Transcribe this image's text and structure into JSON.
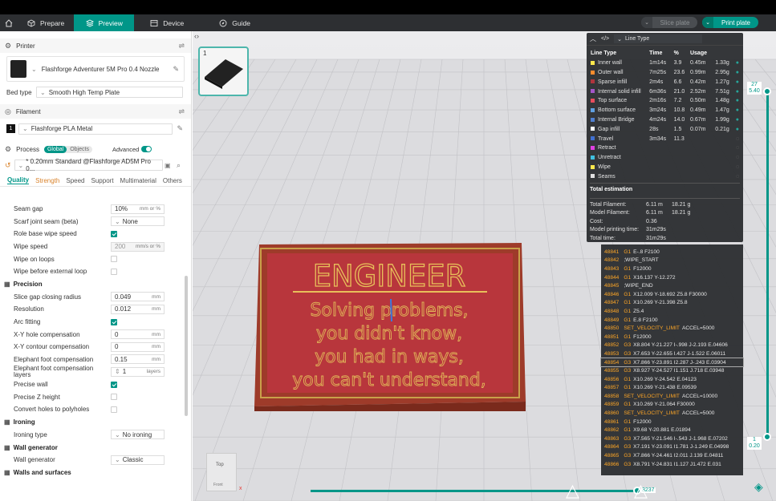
{
  "nav": {
    "tabs": [
      {
        "label": "Prepare"
      },
      {
        "label": "Preview"
      },
      {
        "label": "Device"
      },
      {
        "label": "Guide"
      }
    ],
    "slice": "Slice plate",
    "print": "Print plate"
  },
  "printer": {
    "section": "Printer",
    "name": "Flashforge Adventurer 5M Pro 0.4 Nozzle",
    "bedtype_label": "Bed type",
    "bedtype": "Smooth High Temp Plate"
  },
  "filament": {
    "section": "Filament",
    "index": "1",
    "name": "Flashforge PLA Metal"
  },
  "process": {
    "section": "Process",
    "global": "Global",
    "objects": "Objects",
    "advanced": "Advanced",
    "preset": "* 0.20mm Standard @Flashforge AD5M Pro 0...",
    "tabs": [
      "Quality",
      "Strength",
      "Speed",
      "Support",
      "Multimaterial",
      "Others"
    ]
  },
  "params": [
    {
      "kind": "row",
      "label": "Seam gap",
      "type": "input",
      "value": "10%",
      "unit": "mm or %"
    },
    {
      "kind": "row",
      "label": "Scarf joint seam (beta)",
      "type": "select",
      "value": "None"
    },
    {
      "kind": "row",
      "label": "Role base wipe speed",
      "type": "check",
      "on": true
    },
    {
      "kind": "row",
      "label": "Wipe speed",
      "type": "input",
      "value": "200",
      "unit": "mm/s or %",
      "disabled": true
    },
    {
      "kind": "row",
      "label": "Wipe on loops",
      "type": "check",
      "on": false
    },
    {
      "kind": "row",
      "label": "Wipe before external loop",
      "type": "check",
      "on": false
    },
    {
      "kind": "group",
      "label": "Precision"
    },
    {
      "kind": "row",
      "label": "Slice gap closing radius",
      "type": "input",
      "value": "0.049",
      "unit": "mm"
    },
    {
      "kind": "row",
      "label": "Resolution",
      "type": "input",
      "value": "0.012",
      "unit": "mm"
    },
    {
      "kind": "row",
      "label": "Arc fitting",
      "type": "check",
      "on": true
    },
    {
      "kind": "row",
      "label": "X-Y hole compensation",
      "type": "input",
      "value": "0",
      "unit": "mm"
    },
    {
      "kind": "row",
      "label": "X-Y contour compensation",
      "type": "input",
      "value": "0",
      "unit": "mm"
    },
    {
      "kind": "row",
      "label": "Elephant foot compensation",
      "type": "input",
      "value": "0.15",
      "unit": "mm"
    },
    {
      "kind": "row",
      "label": "Elephant foot compensation layers",
      "type": "spin",
      "value": "1",
      "unit": "layers"
    },
    {
      "kind": "row",
      "label": "Precise wall",
      "type": "check",
      "on": true
    },
    {
      "kind": "row",
      "label": "Precise Z height",
      "type": "check",
      "on": false
    },
    {
      "kind": "row",
      "label": "Convert holes to polyholes",
      "type": "check",
      "on": false
    },
    {
      "kind": "group",
      "label": "Ironing"
    },
    {
      "kind": "row",
      "label": "Ironing type",
      "type": "select",
      "value": "No ironing"
    },
    {
      "kind": "group",
      "label": "Wall generator"
    },
    {
      "kind": "row",
      "label": "Wall generator",
      "type": "select",
      "value": "Classic"
    },
    {
      "kind": "group",
      "label": "Walls and surfaces"
    }
  ],
  "viewport": {
    "plate_num": "1",
    "view_top": "Top",
    "view_front": "Front",
    "layer_top": "27",
    "layer_top_z": "5.40",
    "layer_bot": "1",
    "layer_bot_z": "0.20",
    "move": "3237",
    "sign": {
      "title": "ENGINEER",
      "lines": [
        "Solving problems,",
        "you didn't know,",
        "you had in ways,",
        "you can't understand,"
      ]
    }
  },
  "legend": {
    "dropdown": "Line Type",
    "headers": [
      "Line Type",
      "Time",
      "%",
      "Usage"
    ],
    "rows": [
      {
        "name": "Inner wall",
        "color": "#ffe84d",
        "time": "1m14s",
        "pct": "3.9",
        "len": "0.45m",
        "g": "1.33g"
      },
      {
        "name": "Outer wall",
        "color": "#ff8c2e",
        "time": "7m25s",
        "pct": "23.6",
        "len": "0.99m",
        "g": "2.95g"
      },
      {
        "name": "Sparse infill",
        "color": "#b0343d",
        "time": "2m4s",
        "pct": "6.6",
        "len": "0.42m",
        "g": "1.27g"
      },
      {
        "name": "Internal solid infill",
        "color": "#a456c9",
        "time": "6m36s",
        "pct": "21.0",
        "len": "2.52m",
        "g": "7.51g"
      },
      {
        "name": "Top surface",
        "color": "#e84d5d",
        "time": "2m16s",
        "pct": "7.2",
        "len": "0.50m",
        "g": "1.48g"
      },
      {
        "name": "Bottom surface",
        "color": "#60a0e0",
        "time": "3m24s",
        "pct": "10.8",
        "len": "0.49m",
        "g": "1.47g"
      },
      {
        "name": "Internal Bridge",
        "color": "#5080d0",
        "time": "4m24s",
        "pct": "14.0",
        "len": "0.67m",
        "g": "1.99g"
      },
      {
        "name": "Gap infill",
        "color": "#ffffff",
        "time": "28s",
        "pct": "1.5",
        "len": "0.07m",
        "g": "0.21g"
      },
      {
        "name": "Travel",
        "color": "#4070d0",
        "time": "3m34s",
        "pct": "11.3",
        "len": "",
        "g": ""
      },
      {
        "name": "Retract",
        "color": "#e040e0",
        "time": "",
        "pct": "",
        "len": "",
        "g": ""
      },
      {
        "name": "Unretract",
        "color": "#40c0e0",
        "time": "",
        "pct": "",
        "len": "",
        "g": ""
      },
      {
        "name": "Wipe",
        "color": "#ffe84d",
        "time": "",
        "pct": "",
        "len": "",
        "g": ""
      },
      {
        "name": "Seams",
        "color": "#e0e0e0",
        "time": "",
        "pct": "",
        "len": "",
        "g": ""
      }
    ],
    "total_label": "Total estimation",
    "totals": [
      {
        "k": "Total Filament:",
        "v1": "6.11 m",
        "v2": "18.21 g"
      },
      {
        "k": "Model Filament:",
        "v1": "6.11 m",
        "v2": "18.21 g"
      },
      {
        "k": "Cost:",
        "v1": "0.36",
        "v2": ""
      },
      {
        "k": "Model printing time:",
        "v1": "31m29s",
        "v2": ""
      },
      {
        "k": "Total time:",
        "v1": "31m29s",
        "v2": ""
      }
    ]
  },
  "gcode": [
    {
      "n": "48841",
      "c": "G1",
      "t": "E-.8 F2100"
    },
    {
      "n": "48842",
      "c": "",
      "t": ";WIPE_START"
    },
    {
      "n": "48843",
      "c": "G1",
      "t": "F12000"
    },
    {
      "n": "48844",
      "c": "G1",
      "t": "X16.137 Y-12.272"
    },
    {
      "n": "48845",
      "c": "",
      "t": ";WIPE_END"
    },
    {
      "n": "48846",
      "c": "G1",
      "t": "X12.009 Y-18.692 Z5.8 F30000"
    },
    {
      "n": "48847",
      "c": "G1",
      "t": "X10.269 Y-21.398 Z5.8"
    },
    {
      "n": "48848",
      "c": "G1",
      "t": "Z5.4"
    },
    {
      "n": "48849",
      "c": "G1",
      "t": "E.8 F2100"
    },
    {
      "n": "48850",
      "c": "SET_VELOCITY_LIMIT",
      "t": "ACCEL=5000"
    },
    {
      "n": "48851",
      "c": "G1",
      "t": "F12000"
    },
    {
      "n": "48852",
      "c": "G3",
      "t": "X8.804 Y-21.227 I-.998 J-2.193 E.04606"
    },
    {
      "n": "48853",
      "c": "G3",
      "t": "X7.653 Y-22.655 I.427 J-1.522 E.06011"
    },
    {
      "n": "48854",
      "c": "G3",
      "t": "X7.866 Y-23.891 I2.287 J-.243 E.03904"
    },
    {
      "n": "48855",
      "c": "G3",
      "t": "X8.927 Y-24.527 I1.151 J.718 E.03948"
    },
    {
      "n": "48856",
      "c": "G1",
      "t": "X10.269 Y-24.542 E.04123"
    },
    {
      "n": "48857",
      "c": "G1",
      "t": "X10.269 Y-21.438 E.09539"
    },
    {
      "n": "48858",
      "c": "SET_VELOCITY_LIMIT",
      "t": "ACCEL=10000"
    },
    {
      "n": "48859",
      "c": "G1",
      "t": "X10.269 Y-21.064 F30000"
    },
    {
      "n": "48860",
      "c": "SET_VELOCITY_LIMIT",
      "t": "ACCEL=5000"
    },
    {
      "n": "48861",
      "c": "G1",
      "t": "F12000"
    },
    {
      "n": "48862",
      "c": "G1",
      "t": "X9.68 Y-20.881 E.01894"
    },
    {
      "n": "48863",
      "c": "G3",
      "t": "X7.565 Y-21.546 I-.543 J-1.968 E.07202"
    },
    {
      "n": "48864",
      "c": "G3",
      "t": "X7.191 Y-23.091 I1.781 J-1.249 E.04998"
    },
    {
      "n": "48865",
      "c": "G3",
      "t": "X7.866 Y-24.461 I2.011 J.139 E.04811"
    },
    {
      "n": "48866",
      "c": "G3",
      "t": "X8.791 Y-24.831 I1.127 J1.472 E.031"
    }
  ]
}
